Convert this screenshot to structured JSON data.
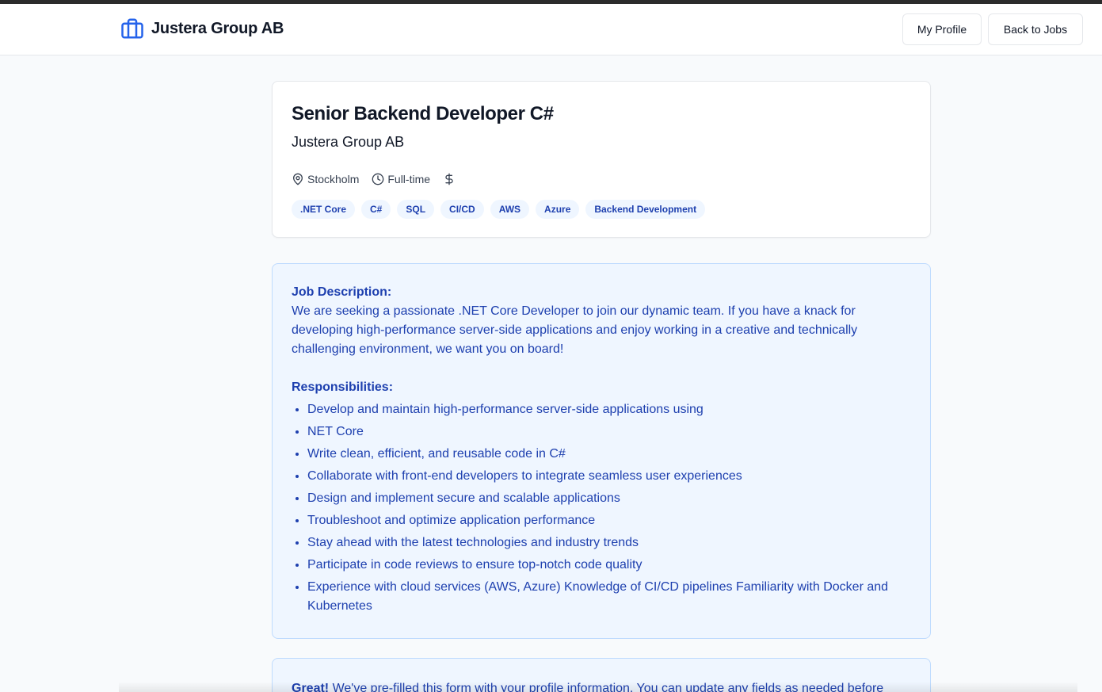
{
  "header": {
    "brand_name": "Justera Group AB",
    "my_profile_label": "My Profile",
    "back_label": "Back to Jobs"
  },
  "job": {
    "title": "Senior Backend Developer C#",
    "company": "Justera Group AB",
    "location": "Stockholm",
    "type": "Full-time",
    "tags": [
      ".NET Core",
      "C#",
      "SQL",
      "CI/CD",
      "AWS",
      "Azure",
      "Backend Development"
    ]
  },
  "description": {
    "heading": "Job Description:",
    "text": "We are seeking a passionate .NET Core Developer to join our dynamic team. If you have a knack for developing high-performance server-side applications and enjoy working in a creative and technically challenging environment, we want you on board!",
    "resp_heading": "Responsibilities:",
    "responsibilities": [
      "Develop and maintain high-performance server-side applications using",
      "NET Core",
      "Write clean, efficient, and reusable code in C#",
      "Collaborate with front-end developers to integrate seamless user experiences",
      "Design and implement secure and scalable applications",
      "Troubleshoot and optimize application performance",
      "Stay ahead with the latest technologies and industry trends",
      "Participate in code reviews to ensure top-notch code quality",
      "Experience with cloud services (AWS, Azure) Knowledge of CI/CD pipelines Familiarity with Docker and Kubernetes"
    ]
  },
  "notice": {
    "bold": "Great!",
    "text": " We've pre-filled this form with your profile information. You can update any fields as needed before"
  },
  "colors": {
    "accent": "#2563eb",
    "tag_bg": "#eff6ff",
    "tag_text": "#1e40af",
    "panel_border": "#bfdbfe"
  },
  "icons": {
    "brand": "briefcase-icon",
    "location": "map-pin-icon",
    "type": "clock-icon",
    "salary": "dollar-icon"
  }
}
